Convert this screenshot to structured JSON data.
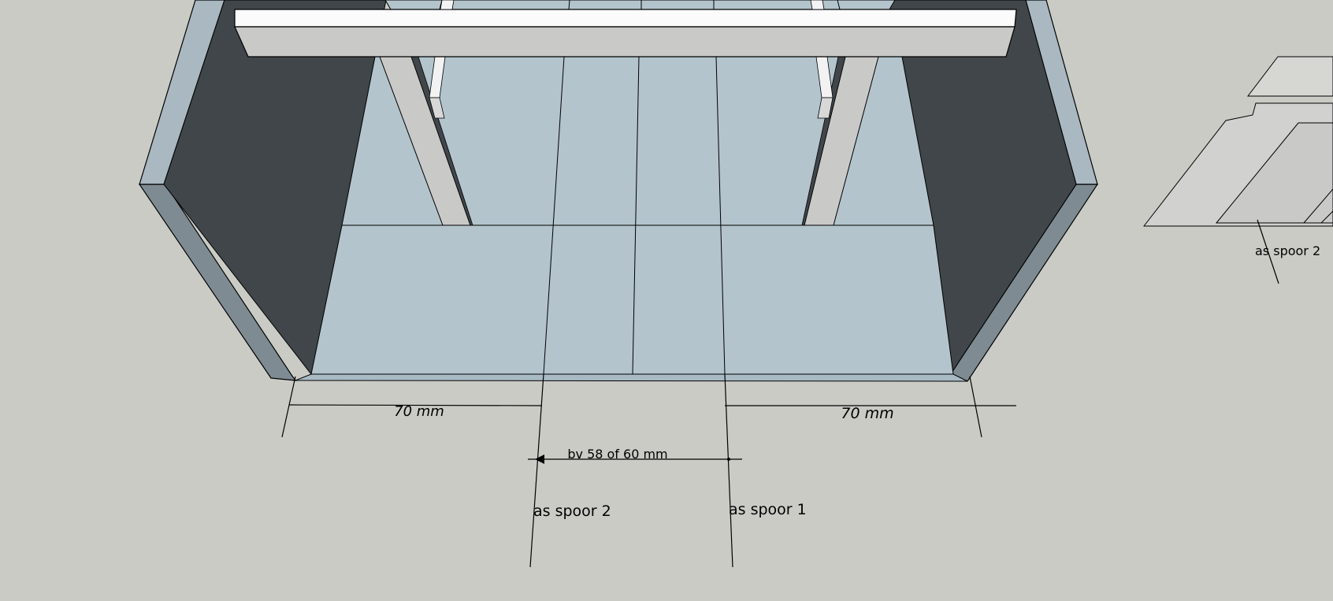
{
  "model_view": {
    "dimensions": {
      "left_clearance": "70 mm",
      "right_clearance": "70 mm",
      "track_spacing": "bv 58 of 60 mm"
    },
    "labels": {
      "track_2": "as spoor 2",
      "track_1": "as spoor 1",
      "secondary_track_2": "as spoor 2"
    },
    "colors": {
      "background": "#cbcbc6",
      "floor": "#b3c4cd",
      "dark_wall": "#41464a",
      "wall_edge": "#a9b8c1",
      "beam": "#c9c9c7",
      "line": "#000000"
    }
  }
}
